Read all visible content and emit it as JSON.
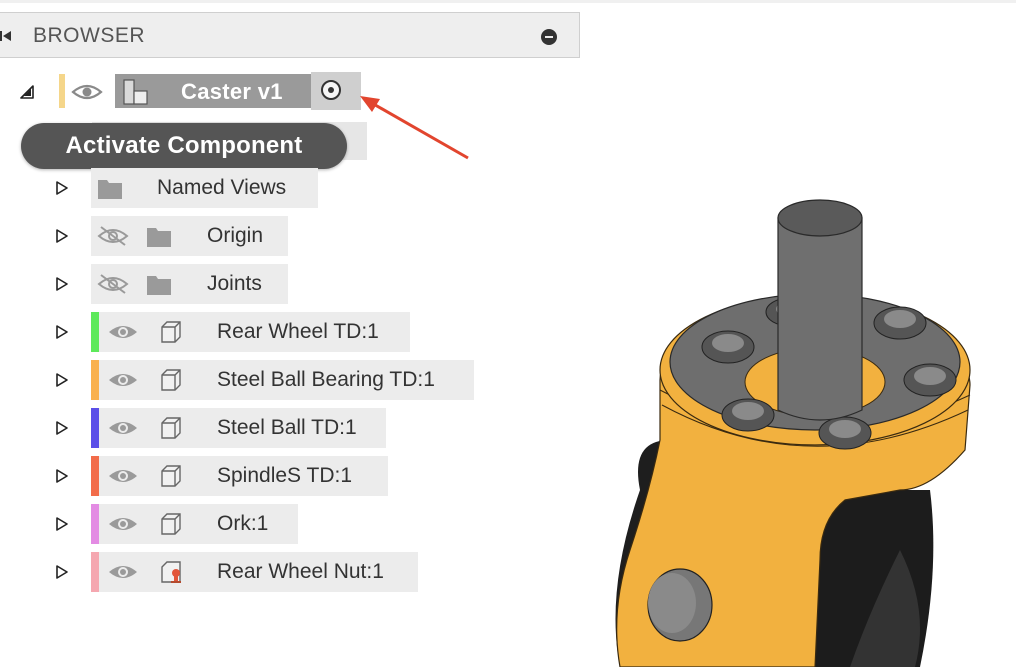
{
  "browser": {
    "title": "BROWSER"
  },
  "root": {
    "label": "Caster v1",
    "color": "#f5d68a"
  },
  "tooltip": {
    "text": "Activate Component"
  },
  "tree_items": [
    {
      "label": "Named Views",
      "kind": "folder",
      "visibility": "none"
    },
    {
      "label": "Origin",
      "kind": "folder",
      "visibility": "hidden"
    },
    {
      "label": "Joints",
      "kind": "folder",
      "visibility": "hidden"
    },
    {
      "label": "Rear Wheel TD:1",
      "kind": "component",
      "visibility": "visible",
      "color": "#5de95b"
    },
    {
      "label": "Steel Ball Bearing TD:1",
      "kind": "component",
      "visibility": "visible",
      "color": "#f9b14e"
    },
    {
      "label": "Steel Ball TD:1",
      "kind": "component",
      "visibility": "visible",
      "color": "#5b4fe8"
    },
    {
      "label": "SpindleS TD:1",
      "kind": "component",
      "visibility": "visible",
      "color": "#f26c4a"
    },
    {
      "label": "Ork:1",
      "kind": "component",
      "visibility": "visible",
      "color": "#e38be3"
    },
    {
      "label": "Rear Wheel Nut:1",
      "kind": "component-pinned",
      "visibility": "visible",
      "color": "#f5a7b0"
    }
  ]
}
